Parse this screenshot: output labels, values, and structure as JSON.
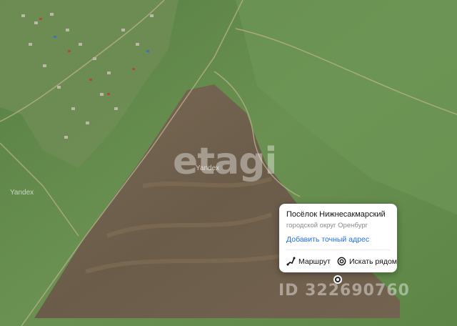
{
  "map": {
    "watermark": "etagi",
    "listing_id": "ID 322690760",
    "provider_labels": [
      "Yandex",
      "Yandex"
    ]
  },
  "place_card": {
    "title": "Посёлок Нижнесакмарский",
    "subtitle": "городской округ Оренбург",
    "add_address_link": "Добавить точный адрес",
    "route_label": "Маршрут",
    "nearby_label": "Искать рядом"
  },
  "icons": {
    "route": "route-icon",
    "nearby": "search-nearby-icon",
    "marker": "location-marker-icon"
  },
  "colors": {
    "link": "#1f6fe5",
    "field": "#6b5a4b",
    "grass": "#5f8a4a"
  }
}
